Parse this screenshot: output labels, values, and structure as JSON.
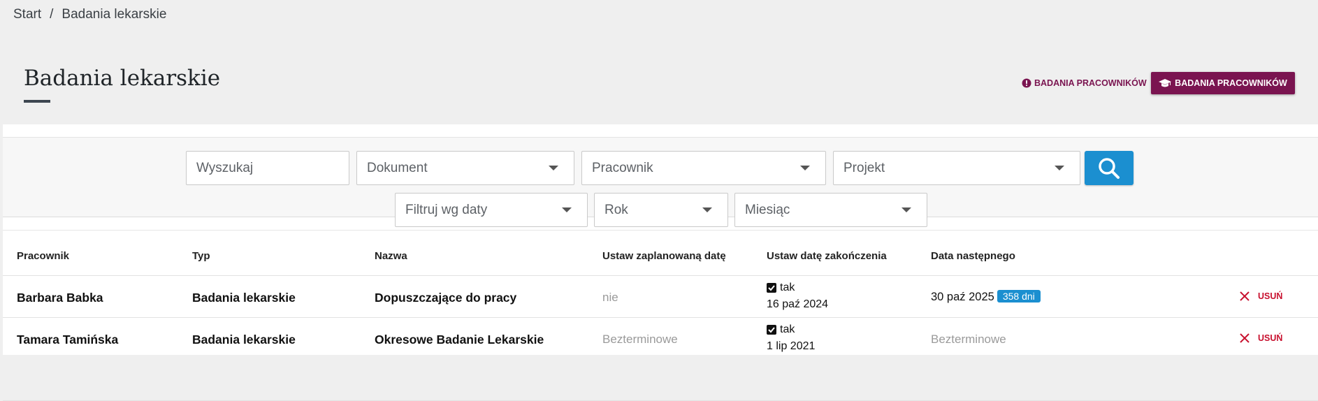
{
  "breadcrumb": {
    "home": "Start",
    "separator": "/",
    "current": "Badania lekarskie"
  },
  "page": {
    "title": "Badania lekarskie"
  },
  "actions": {
    "link_label": "BADANIA PRACOWNIKÓW",
    "primary_label": "BADANIA PRACOWNIKÓW"
  },
  "filters": {
    "search_placeholder": "Wyszukaj",
    "document": "Dokument",
    "employee": "Pracownik",
    "project": "Projekt",
    "date_filter": "Filtruj wg daty",
    "year": "Rok",
    "month": "Miesiąc"
  },
  "table": {
    "headers": {
      "employee": "Pracownik",
      "type": "Typ",
      "name": "Nazwa",
      "planned": "Ustaw zaplanowaną datę",
      "completed": "Ustaw datę zakończenia",
      "next": "Data następnego"
    },
    "rows": [
      {
        "employee": "Barbara Babka",
        "type": "Badania lekarskie",
        "name": "Dopuszczające do pracy",
        "planned": "nie",
        "completed_flag": "tak",
        "completed_date": "16 paź 2024",
        "next": "30 paź 2025",
        "badge": "358 dni",
        "delete": "USUŃ"
      },
      {
        "employee": "Tamara Tamińska",
        "type": "Badania lekarskie",
        "name": "Okresowe Badanie Lekarskie",
        "planned": "Bezterminowe",
        "completed_flag": "tak",
        "completed_date": "1 lip 2021",
        "next": "Bezterminowe",
        "badge": "",
        "delete": "USUŃ"
      }
    ]
  },
  "colors": {
    "brand": "#7a1450",
    "accent": "#1b8fd0",
    "danger": "#c8102e"
  },
  "icons": {
    "link": "exclamation-circle-icon",
    "primary": "graduation-cap-icon",
    "search": "search-icon",
    "check": "checkbox-checked-icon",
    "delete": "close-icon"
  }
}
